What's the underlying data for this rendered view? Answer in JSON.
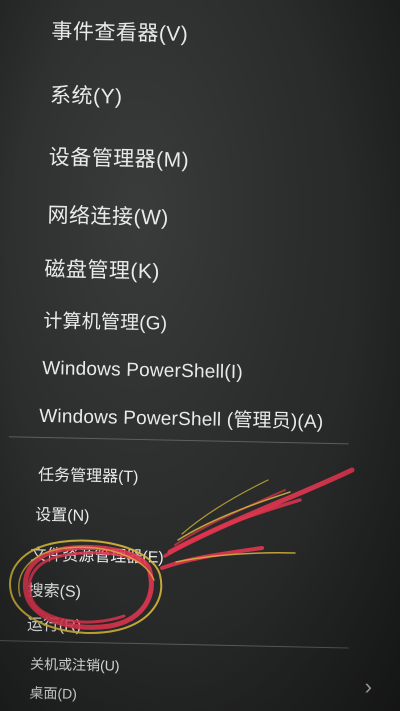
{
  "menu": {
    "items": [
      {
        "id": "event-viewer",
        "label": "事件查看器(V)"
      },
      {
        "id": "system",
        "label": "系统(Y)"
      },
      {
        "id": "device-manager",
        "label": "设备管理器(M)"
      },
      {
        "id": "network",
        "label": "网络连接(W)"
      },
      {
        "id": "disk-management",
        "label": "磁盘管理(K)"
      },
      {
        "id": "computer-management",
        "label": "计算机管理(G)"
      },
      {
        "id": "powershell",
        "label": "Windows PowerShell(I)"
      },
      {
        "id": "powershell-admin",
        "label": "Windows PowerShell (管理员)(A)"
      },
      {
        "id": "task-manager",
        "label": "任务管理器(T)"
      },
      {
        "id": "settings",
        "label": "设置(N)"
      },
      {
        "id": "file-explorer",
        "label": "文件资源管理器(E)"
      },
      {
        "id": "search",
        "label": "搜索(S)"
      },
      {
        "id": "run",
        "label": "运行(R)"
      },
      {
        "id": "shutdown",
        "label": "关机或注销(U)"
      },
      {
        "id": "desktop",
        "label": "桌面(D)"
      }
    ],
    "submenu_icon": "chevron-right-icon",
    "submenu_glyph": "›"
  },
  "annotation": {
    "highlighted_item": "搜索(S)",
    "colors": {
      "red": "#e0354f",
      "yellow": "#d6b73a"
    }
  }
}
